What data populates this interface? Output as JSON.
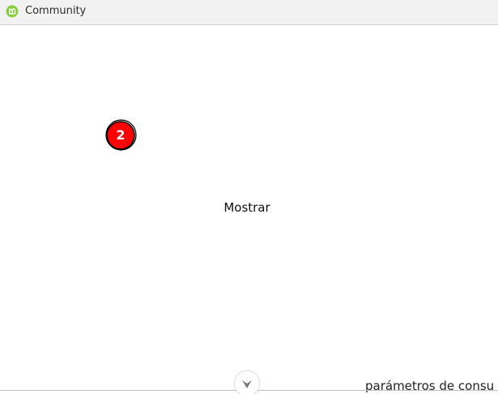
{
  "window": {
    "title": "Community",
    "app_icon": "linux-mint-logo-icon",
    "accent_color": "#87cf3e"
  },
  "overlay": {
    "step_badge": {
      "number": "2",
      "color": "#ff0000"
    },
    "show_label": "Mostrar",
    "scroll_icon": "chevron-down-icon"
  },
  "underlying_page": {
    "partial_text": "parámetros de consu"
  }
}
